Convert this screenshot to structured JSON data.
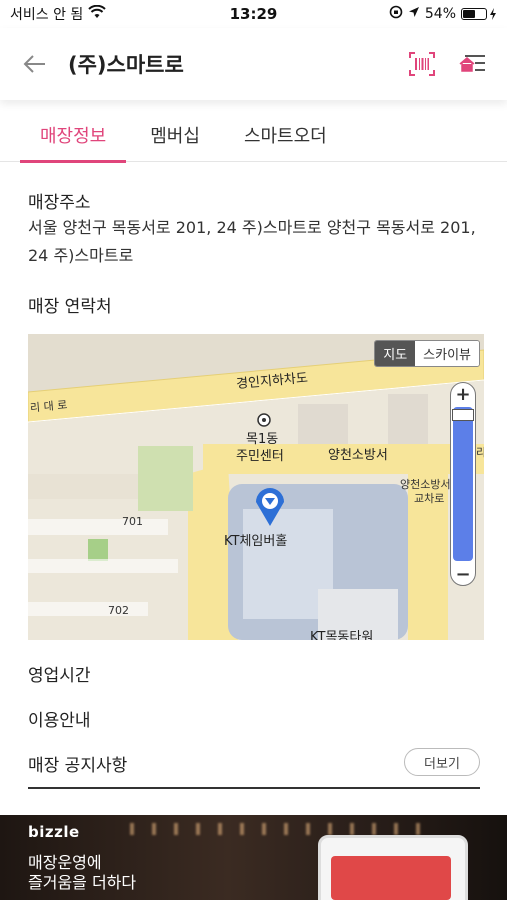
{
  "status_bar": {
    "carrier": "서비스 안 됨",
    "time": "13:29",
    "battery": "54%",
    "battery_level": 0.54
  },
  "header": {
    "title": "(주)스마트로"
  },
  "tabs": [
    {
      "label": "매장정보",
      "active": true
    },
    {
      "label": "멤버십",
      "active": false
    },
    {
      "label": "스마트오더",
      "active": false
    }
  ],
  "store": {
    "address_label": "매장주소",
    "address": "서울 양천구 목동서로 201, 24 주)스마트로 양천구 목동서로 201, 24 주)스마트로",
    "contact_label": "매장 연락처"
  },
  "map": {
    "toggle_map": "지도",
    "toggle_sky": "스카이뷰",
    "labels": {
      "road_tunnel": "경인지하차도",
      "road_left": "리 대 로",
      "mokdong_center_1": "목1동",
      "mokdong_center_2": "주민센터",
      "fire_station": "양천소방서",
      "intersection_1": "양천소방서",
      "intersection_2": "교차로",
      "partial_right": "리",
      "hall": "KT체임버홀",
      "bldg_701": "701",
      "bldg_702": "702",
      "tower": "KT목동타워"
    },
    "zoom_in": "+",
    "zoom_out": "−"
  },
  "sections": {
    "hours": "영업시간",
    "guide": "이용안내",
    "notice": "매장 공지사항",
    "more_button": "더보기"
  },
  "banner": {
    "brand": "bizzle",
    "line1": "매장운영에",
    "line2": "즐거움을 더하다"
  },
  "colors": {
    "accent": "#e0457b",
    "map_bg": "#ece7da",
    "road": "#f7e59a",
    "zoom_track": "#5c7fe8"
  }
}
